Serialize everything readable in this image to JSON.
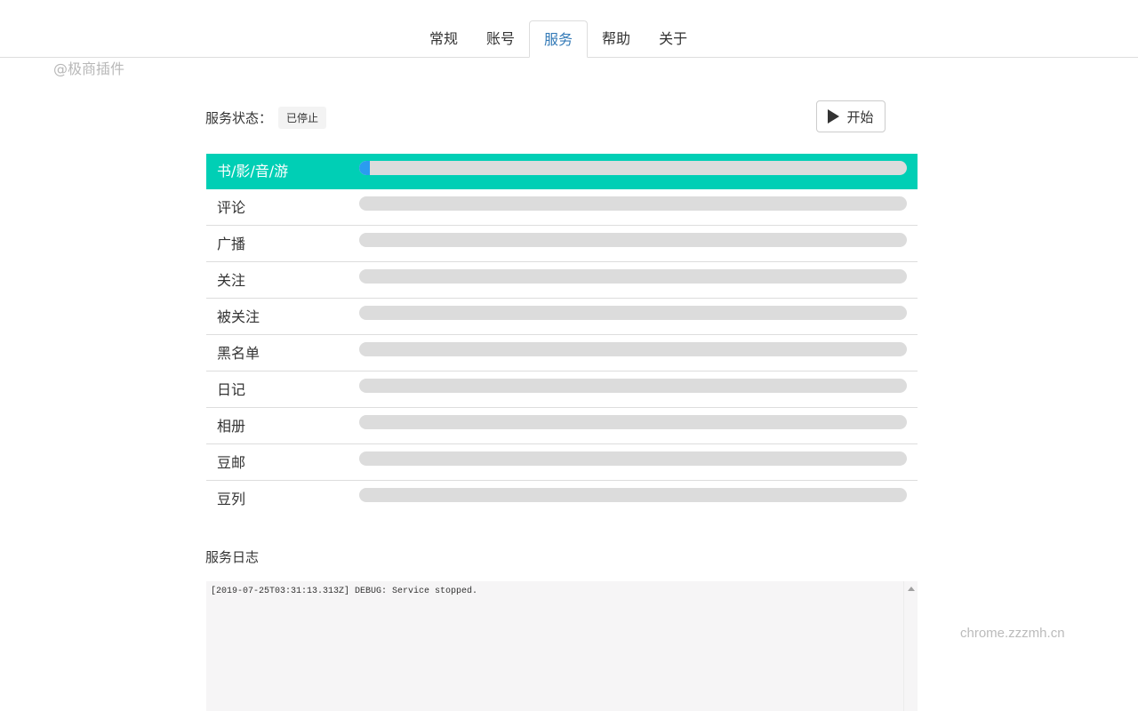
{
  "tabs": [
    {
      "label": "常规",
      "active": false
    },
    {
      "label": "账号",
      "active": false
    },
    {
      "label": "服务",
      "active": true
    },
    {
      "label": "帮助",
      "active": false
    },
    {
      "label": "关于",
      "active": false
    }
  ],
  "watermarks": {
    "top": "@极商插件",
    "bottom": "chrome.zzzmh.cn"
  },
  "service": {
    "status_label": "服务状态：",
    "status_value": "已停止",
    "start_button": "开始",
    "start_icon": "play-icon"
  },
  "services": [
    {
      "name": "书/影/音/游",
      "progress": 0.02,
      "active": true
    },
    {
      "name": "评论",
      "progress": 0
    },
    {
      "name": "广播",
      "progress": 0
    },
    {
      "name": "关注",
      "progress": 0
    },
    {
      "name": "被关注",
      "progress": 0
    },
    {
      "name": "黑名单",
      "progress": 0
    },
    {
      "name": "日记",
      "progress": 0
    },
    {
      "name": "相册",
      "progress": 0
    },
    {
      "name": "豆邮",
      "progress": 0
    },
    {
      "name": "豆列",
      "progress": 0
    }
  ],
  "log": {
    "title": "服务日志",
    "lines": [
      "[2019-07-25T03:31:13.313Z] DEBUG: Service stopped."
    ]
  },
  "colors": {
    "active_row": "#00cfb5",
    "progress_fill": "#2a9cf0",
    "progress_track": "#dcdcdc",
    "active_tab_text": "#337ab7"
  }
}
